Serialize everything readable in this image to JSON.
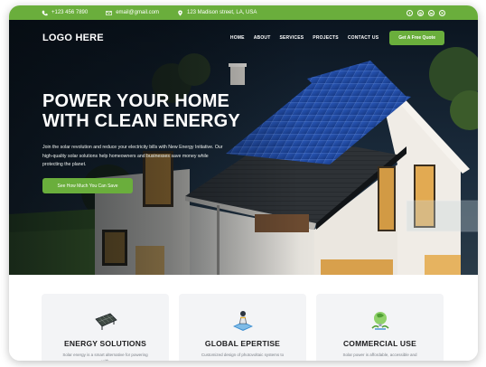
{
  "topbar": {
    "phone": "+123 456 7890",
    "email": "email@gmail.com",
    "address": "123 Madison street, LA, USA",
    "socials": [
      {
        "icon": "facebook-icon",
        "glyph": "f"
      },
      {
        "icon": "instagram-icon",
        "glyph": "◎"
      },
      {
        "icon": "linkedin-icon",
        "glyph": "in"
      },
      {
        "icon": "x-icon",
        "glyph": "✕"
      }
    ]
  },
  "nav": {
    "logo": "LOGO HERE",
    "items": [
      "HOME",
      "ABOUT",
      "SERVICES",
      "PROJECTS",
      "CONTACT US"
    ],
    "cta": "Get A Free Quote"
  },
  "hero": {
    "title_line1": "POWER YOUR HOME",
    "title_line2": "WITH CLEAN ENERGY",
    "lead": "Join the solar revolution and reduce your electricity bills with New Energy Initiative. Our high-quality solar solutions help homeowners and businesses save money while protecting the planet.",
    "cta": "See How Much You Can Save"
  },
  "cards": [
    {
      "icon": "solar-panel-icon",
      "title": "ENERGY SOLUTIONS",
      "desc": "Solar energy is a smart alternative for powering with"
    },
    {
      "icon": "engineer-icon",
      "title": "GLOBAL EPERTISE",
      "desc": "Customized design of photovoltaic systems to"
    },
    {
      "icon": "eco-energy-icon",
      "title": "COMMERCIAL USE",
      "desc": "Solar power is affordable, accessible and"
    }
  ],
  "colors": {
    "accent": "#6aae3c",
    "dark": "#1d1d1f",
    "card_bg": "#f3f4f6"
  }
}
